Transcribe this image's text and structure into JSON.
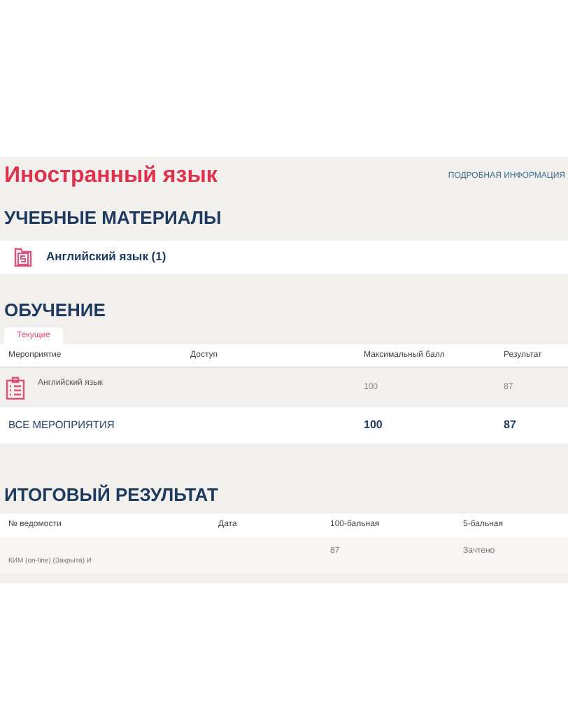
{
  "title": "Иностранный язык",
  "details_link": "ПОДРОБНАЯ ИНФОРМАЦИЯ",
  "materials": {
    "heading": "УЧЕБНЫЕ МАТЕРИАЛЫ",
    "items": [
      "Английский язык (1)"
    ]
  },
  "learning": {
    "heading": "ОБУЧЕНИЕ",
    "tabs": [
      {
        "label": "Текущие",
        "selected": true
      }
    ],
    "columns": [
      "Мероприятие",
      "Доступ",
      "Максимальный балл",
      "Результат"
    ],
    "rows": [
      {
        "event": "Английский язык",
        "access": "",
        "max": "100",
        "result": "87"
      }
    ],
    "total": {
      "label": "ВСЕ МЕРОПРИЯТИЯ",
      "max": "100",
      "result": "87"
    }
  },
  "final": {
    "heading": "ИТОГОВЫЙ РЕЗУЛЬТАТ",
    "columns": [
      "№ ведомости",
      "Дата",
      "100-бальная",
      "5-бальная"
    ],
    "rows": [
      {
        "sheet": "КИМ (on-line) (Закрыта) И",
        "date": "",
        "score100": "87",
        "score5": "Зачтено"
      }
    ]
  }
}
